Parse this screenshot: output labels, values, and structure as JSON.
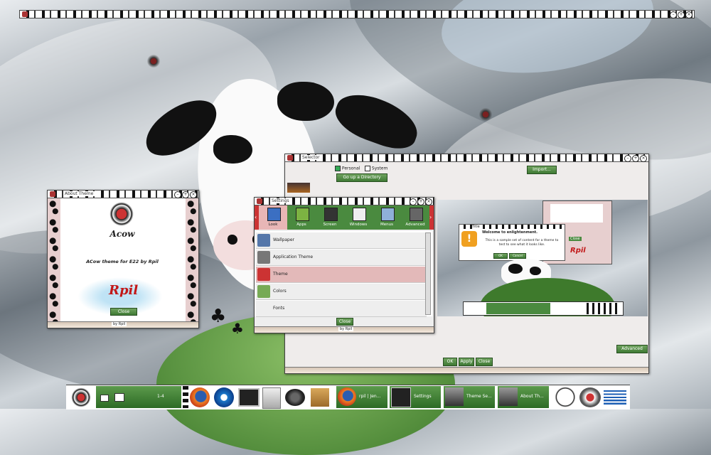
{
  "top_window": {
    "title": ""
  },
  "about_theme": {
    "title": "About Theme",
    "logo_text": "Acow",
    "caption": "ACow theme for E22 by Rpil",
    "signature": "Rpil",
    "close_label": "Close",
    "footer": "by Rpil"
  },
  "selector": {
    "title": "Selector",
    "tab_personal": "Personal",
    "tab_system": "System",
    "directory_button": "Go up a Directory",
    "import_button": "Import...",
    "advanced_button": "Advanced",
    "ok_label": "OK",
    "apply_label": "Apply",
    "close_label": "Close"
  },
  "settings_window": {
    "title": "Settings",
    "categories": [
      "Look",
      "Apps",
      "Screen",
      "Windows",
      "Menus",
      "Advanced"
    ],
    "items": [
      "Wallpaper",
      "Application Theme",
      "Theme",
      "Colors",
      "Fonts"
    ],
    "close_label": "Close",
    "footer": "by Rpil"
  },
  "preview": {
    "dialog_title": "Title",
    "dialog_heading": "Welcome to enlightenment.",
    "dialog_body": "This is a sample set of content for a theme to test to see what it looks like.",
    "ok_label": "OK",
    "cancel_label": "Cancel",
    "mini_close": "Close",
    "mini_sig": "Rpil"
  },
  "taskbar": {
    "pager_label": "1-4",
    "tasks": [
      "rpil | Jen...",
      "Settings",
      "Theme Se...",
      "About Th..."
    ]
  },
  "colors": {
    "accent_green": "#4a8a3f",
    "cow_black": "#111111",
    "frame_pink": "#e7cfcf"
  }
}
